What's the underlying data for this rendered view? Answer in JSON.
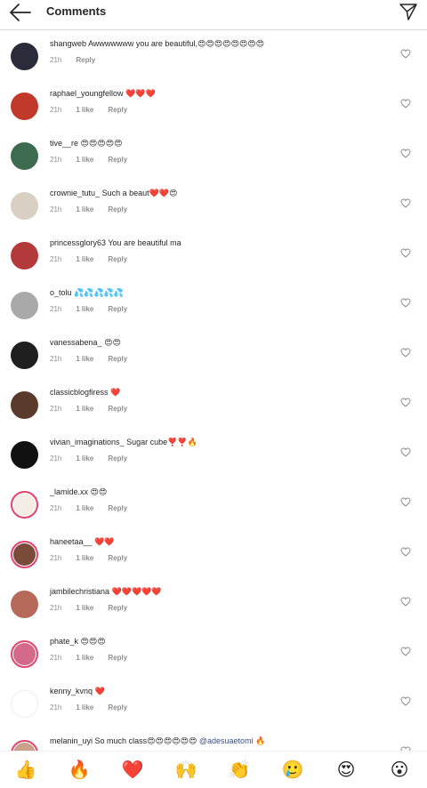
{
  "header": {
    "title": "Comments",
    "back_icon": "arrow-left-icon",
    "send_icon": "paper-plane-icon"
  },
  "colors": {
    "text": "#262626",
    "secondary": "#8e8e8e",
    "mention": "#385185",
    "story_ring": "#e0446f"
  },
  "comments": [
    {
      "username": "shangweb",
      "text": "Awwwwwww you are beautiful,",
      "emojis": "😍😍😍😍😍😍😍😍",
      "time": "21h",
      "likes": "",
      "reply": "Reply",
      "avatar_color": "#2b2b3a"
    },
    {
      "username": "raphael_youngfellow",
      "text": "",
      "emojis": "❤️❤️❤️",
      "time": "21h",
      "likes": "1 like",
      "reply": "Reply",
      "avatar_color": "#c0392b"
    },
    {
      "username": "tive__re",
      "text": "",
      "emojis": "😍😍😍😍😍",
      "time": "21h",
      "likes": "1 like",
      "reply": "Reply",
      "avatar_color": "#3d6b4f"
    },
    {
      "username": "crownie_tutu_",
      "text": "Such a beaut",
      "emojis": "❤️❤️😍",
      "time": "21h",
      "likes": "1 like",
      "reply": "Reply",
      "avatar_color": "#d9cfc2"
    },
    {
      "username": "princessglory63",
      "text": "You are beautiful ma",
      "emojis": "",
      "time": "21h",
      "likes": "1 like",
      "reply": "Reply",
      "avatar_color": "#b33a3a"
    },
    {
      "username": "o_tolu",
      "text": "",
      "emojis": "💦💦💦💦💦",
      "time": "21h",
      "likes": "1 like",
      "reply": "Reply",
      "avatar_color": "#a9a9a9"
    },
    {
      "username": "vanessabena_",
      "text": "",
      "emojis": "😍😍",
      "time": "21h",
      "likes": "1 like",
      "reply": "Reply",
      "avatar_color": "#1f1f1f"
    },
    {
      "username": "classicblogfiress",
      "text": "",
      "emojis": "❤️",
      "time": "21h",
      "likes": "1 like",
      "reply": "Reply",
      "avatar_color": "#5a3a2a"
    },
    {
      "username": "vivian_imaginations_",
      "text": "Sugar cube",
      "emojis": "❣️❣️🔥",
      "time": "21h",
      "likes": "1 like",
      "reply": "Reply",
      "avatar_color": "#111111"
    },
    {
      "username": "_lamide.xx",
      "text": "",
      "emojis": "😍😍",
      "time": "21h",
      "likes": "1 like",
      "reply": "Reply",
      "avatar_color": "#f3ede6",
      "ring": true
    },
    {
      "username": "haneetaa__",
      "text": "",
      "emojis": "❤️❤️",
      "time": "21h",
      "likes": "1 like",
      "reply": "Reply",
      "avatar_color": "#7a4a3a",
      "ring": true
    },
    {
      "username": "jambilechristiana",
      "text": "",
      "emojis": "❤️❤️❤️❤️❤️",
      "time": "21h",
      "likes": "1 like",
      "reply": "Reply",
      "avatar_color": "#b56a5a"
    },
    {
      "username": "phate_k",
      "text": "",
      "emojis": "😍😍😍",
      "time": "21h",
      "likes": "1 like",
      "reply": "Reply",
      "avatar_color": "#d46a8a",
      "ring": true
    },
    {
      "username": "kenny_kvnq",
      "text": "",
      "emojis": "❤️",
      "time": "21h",
      "likes": "1 like",
      "reply": "Reply",
      "avatar_color": "#ffffff"
    },
    {
      "username": "melanin_uyi",
      "text": "So much class",
      "emojis": "😍😍😍😍😍😍",
      "mention": "@adesuaetomi",
      "trailing": "🔥",
      "time": "",
      "likes": "",
      "reply": "",
      "avatar_color": "#c9a08a",
      "ring": true
    }
  ],
  "reactions": [
    {
      "emoji": "👍",
      "name": "thumbs-up-icon"
    },
    {
      "emoji": "🔥",
      "name": "fire-icon"
    },
    {
      "emoji": "❤️",
      "name": "red-heart-icon"
    },
    {
      "emoji": "🙌",
      "name": "raising-hands-icon"
    },
    {
      "emoji": "👏",
      "name": "clapping-hands-icon"
    },
    {
      "emoji": "🥲",
      "name": "smiling-tear-icon"
    },
    {
      "emoji": "😍",
      "name": "heart-eyes-icon"
    },
    {
      "emoji": "😮",
      "name": "surprised-face-icon"
    }
  ]
}
